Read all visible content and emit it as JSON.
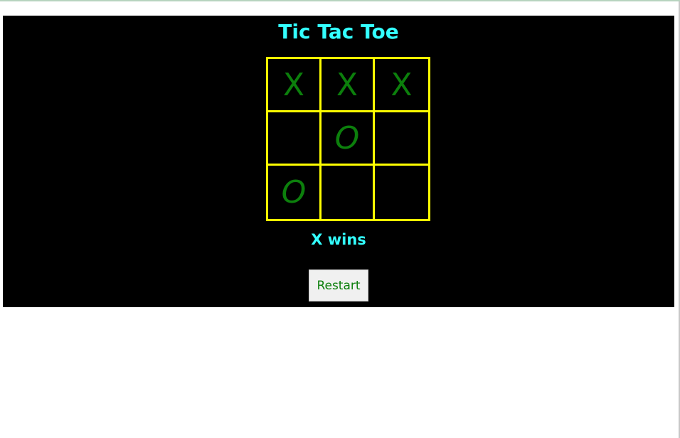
{
  "game": {
    "title": "Tic Tac Toe",
    "board": [
      [
        "X",
        "X",
        "X"
      ],
      [
        "",
        "O",
        ""
      ],
      [
        "O",
        "",
        ""
      ]
    ],
    "status": "X wins",
    "restart_label": "Restart"
  },
  "colors": {
    "panel_background": "#000000",
    "title_text": "#33ffff",
    "grid_lines": "#ffff00",
    "marks": "#0c7f0c",
    "button_background": "#f0f0f0"
  }
}
